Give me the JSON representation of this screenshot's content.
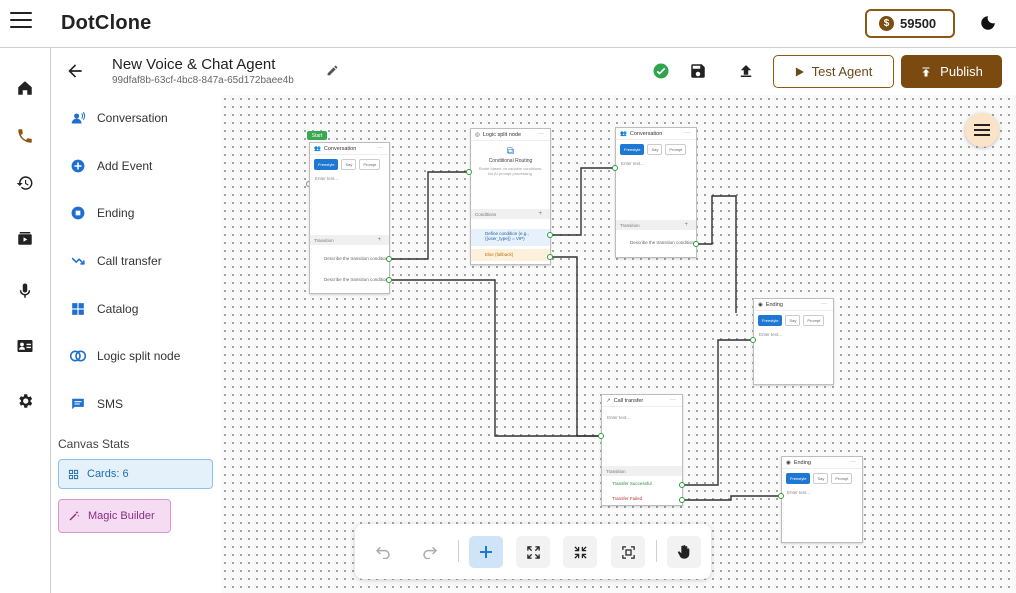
{
  "app": {
    "name": "DotClone",
    "coins": "59500"
  },
  "header": {
    "title": "New Voice & Chat Agent",
    "agent_id": "99dfaf8b-63cf-4bc8-847a-65d172baee4b",
    "test_label": "Test Agent",
    "publish_label": "Publish"
  },
  "palette": {
    "items": [
      {
        "label": "Conversation",
        "icon": "conversation-icon"
      },
      {
        "label": "Add Event",
        "icon": "add-event-icon"
      },
      {
        "label": "Ending",
        "icon": "ending-icon"
      },
      {
        "label": "Call transfer",
        "icon": "call-transfer-icon"
      },
      {
        "label": "Catalog",
        "icon": "catalog-icon"
      },
      {
        "label": "Logic split node",
        "icon": "logic-split-icon"
      },
      {
        "label": "SMS",
        "icon": "sms-icon"
      }
    ],
    "stats_title": "Canvas Stats",
    "cards_label": "Cards: 6",
    "magic_label": "Magic Builder"
  },
  "nodes": {
    "start_tag": "Start",
    "conv1": {
      "title": "Conversation",
      "modes": [
        "Freestyle",
        "Say",
        "Prompt"
      ],
      "placeholder": "Enter text...",
      "transition": "Transition",
      "conditions": [
        "Describe the transition condition",
        "Describe the transition condition"
      ]
    },
    "logic": {
      "title": "Logic split node",
      "routing_title": "Conditional Routing",
      "routing_desc": "Route based on variable conditions. No AI prompt processing.",
      "conditions_label": "Conditions",
      "cond1": "Define condition (e.g., {{user_type}} = VIP)",
      "else": "Else (fallback)"
    },
    "conv2": {
      "title": "Conversation",
      "modes": [
        "Freestyle",
        "Say",
        "Prompt"
      ],
      "placeholder": "Enter text...",
      "transition": "Transition",
      "conditions": [
        "Describe the transition condition"
      ]
    },
    "end1": {
      "title": "Ending",
      "modes": [
        "Freestyle",
        "Say",
        "Prompt"
      ],
      "placeholder": "Enter text..."
    },
    "transfer": {
      "title": "Call transfer",
      "placeholder": "Enter text...",
      "transition": "Transition",
      "success": "Transfer Successful",
      "failed": "Transfer Failed"
    },
    "end2": {
      "title": "Ending",
      "modes": [
        "Freestyle",
        "Say",
        "Prompt"
      ],
      "placeholder": "Enter text..."
    }
  },
  "colors": {
    "accent": "#7a4a10",
    "port": "#2e9e3a",
    "wire": "#333333",
    "active_mode": "#1e78d2"
  }
}
